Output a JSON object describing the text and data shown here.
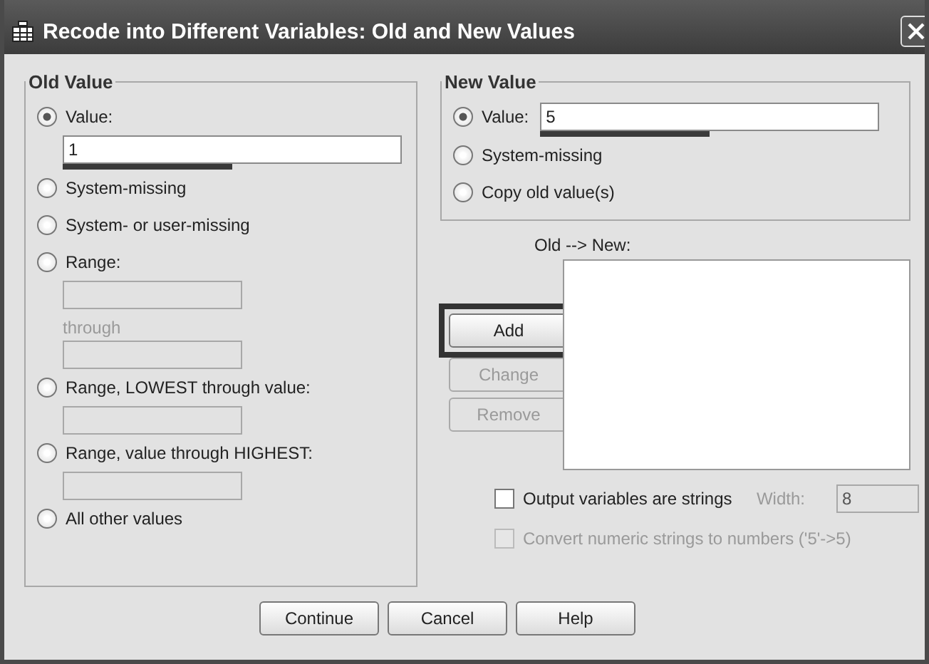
{
  "window": {
    "title": "Recode into Different Variables: Old and New Values"
  },
  "old_value": {
    "title": "Old Value",
    "options": [
      {
        "label": "Value:",
        "selected": true,
        "inputs": [
          {
            "kind": "field",
            "value": "1",
            "disabled": false,
            "marked": true
          }
        ]
      },
      {
        "label": "System-missing",
        "selected": false
      },
      {
        "label": "System- or user-missing",
        "selected": false
      },
      {
        "label": "Range:",
        "selected": false,
        "inputs": [
          {
            "kind": "field",
            "disabled": true
          },
          {
            "kind": "label",
            "text": "through"
          },
          {
            "kind": "field",
            "disabled": true
          }
        ]
      },
      {
        "label": "Range, LOWEST through value:",
        "selected": false,
        "inputs": [
          {
            "kind": "field",
            "disabled": true
          }
        ]
      },
      {
        "label": "Range, value through HIGHEST:",
        "selected": false,
        "inputs": [
          {
            "kind": "field",
            "disabled": true
          }
        ]
      },
      {
        "label": "All other values",
        "selected": false
      }
    ]
  },
  "new_value": {
    "title": "New Value",
    "options": [
      {
        "label": "Value:",
        "selected": true,
        "field": {
          "value": "5",
          "marked": true
        }
      },
      {
        "label": "System-missing",
        "selected": false
      },
      {
        "label": "Copy old value(s)",
        "selected": false
      }
    ]
  },
  "side_buttons": [
    {
      "label": "Add",
      "disabled": false,
      "highlighted": true
    },
    {
      "label": "Change",
      "disabled": true,
      "highlighted": false
    },
    {
      "label": "Remove",
      "disabled": true,
      "highlighted": false
    }
  ],
  "mapping_list": {
    "label": "Old --> New:"
  },
  "checkboxes": [
    {
      "label": "Output variables are strings",
      "checked": false,
      "disabled": false
    },
    {
      "label": "Convert numeric strings to numbers ('5'->5)",
      "checked": false,
      "disabled": true
    }
  ],
  "width": {
    "label": "Width:",
    "value": "8",
    "disabled": true
  },
  "buttons": [
    "Continue",
    "Cancel",
    "Help"
  ]
}
